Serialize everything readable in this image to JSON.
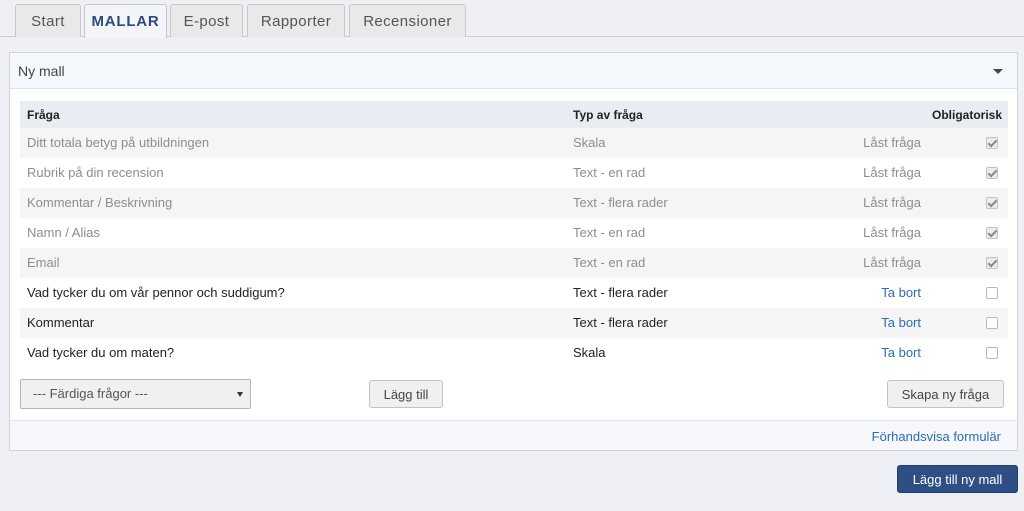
{
  "tabs": [
    {
      "label": "Start"
    },
    {
      "label": "MALLAR"
    },
    {
      "label": "E-post"
    },
    {
      "label": "Rapporter"
    },
    {
      "label": "Recensioner"
    }
  ],
  "panel": {
    "title": "Ny mall",
    "columns": {
      "question": "Fråga",
      "type": "Typ av fråga",
      "required": "Obligatorisk"
    },
    "rows": [
      {
        "question": "Ditt totala betyg på utbildningen",
        "type": "Skala",
        "action": "Låst fråga",
        "required": true
      },
      {
        "question": "Rubrik på din recension",
        "type": "Text - en rad",
        "action": "Låst fråga",
        "required": true
      },
      {
        "question": "Kommentar / Beskrivning",
        "type": "Text - flera rader",
        "action": "Låst fråga",
        "required": true
      },
      {
        "question": "Namn / Alias",
        "type": "Text - en rad",
        "action": "Låst fråga",
        "required": true
      },
      {
        "question": "Email",
        "type": "Text - en rad",
        "action": "Låst fråga",
        "required": true
      },
      {
        "question": "Vad tycker du om vår pennor och suddigum?",
        "type": "Text - flera rader",
        "action": "Ta bort",
        "required": false
      },
      {
        "question": "Kommentar",
        "type": "Text - flera rader",
        "action": "Ta bort",
        "required": false
      },
      {
        "question": "Vad tycker du om maten?",
        "type": "Skala",
        "action": "Ta bort",
        "required": false
      }
    ],
    "select": {
      "value": "--- Färdiga frågor ---"
    },
    "add_button": "Lägg till",
    "create_button": "Skapa ny fråga",
    "preview_link": "Förhandsvisa formulär"
  },
  "add_template_button": "Lägg till ny mall"
}
